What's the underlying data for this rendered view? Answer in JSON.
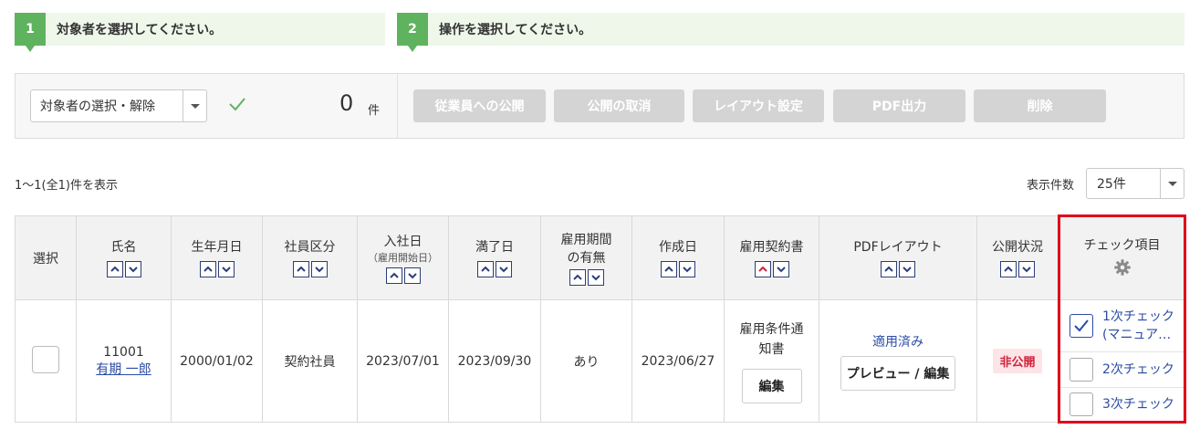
{
  "steps": [
    {
      "num": "1",
      "text": "対象者を選択してください。"
    },
    {
      "num": "2",
      "text": "操作を選択してください。"
    }
  ],
  "panel": {
    "target_select": "対象者の選択・解除",
    "count": "0",
    "count_unit": "件",
    "buttons": {
      "publish": "従業員への公開",
      "unpublish": "公開の取消",
      "layout": "レイアウト設定",
      "pdf": "PDF出力",
      "delete": "削除"
    },
    "button_color": "#d4d4d4"
  },
  "results": {
    "summary": "1〜1(全1)件を表示",
    "per_page_label": "表示件数",
    "per_page_value": "25件"
  },
  "table": {
    "headers": {
      "select": "選択",
      "name": "氏名",
      "birth": "生年月日",
      "emp_type": "社員区分",
      "join_line1": "入社日",
      "join_line2": "（雇用開始日）",
      "expire": "満了日",
      "period_line1": "雇用期間",
      "period_line2": "の有無",
      "created": "作成日",
      "contract": "雇用契約書",
      "pdf_layout": "PDFレイアウト",
      "status": "公開状況",
      "check_items": "チェック項目"
    },
    "row": {
      "emp_no": "11001",
      "name": "有期 一郎",
      "birth": "2000/01/02",
      "emp_type": "契約社員",
      "join": "2023/07/01",
      "expire": "2023/09/30",
      "period": "あり",
      "created": "2023/06/27",
      "contract_line1": "雇用条件通",
      "contract_line2": "知書",
      "contract_edit": "編集",
      "layout_status": "適用済み",
      "preview_edit": "プレビュー / 編集",
      "status": "非公開",
      "checks": [
        {
          "line1": "1次チェック",
          "line2": "(マニュア…",
          "checked": true
        },
        {
          "line1": "2次チェック",
          "checked": false
        },
        {
          "line1": "3次チェック",
          "checked": false
        }
      ]
    }
  },
  "colors": {
    "accent_green": "#5fb35f",
    "link_blue": "#2b4ba5",
    "highlight_red": "#e0001a",
    "badge_red": "#d0243c"
  }
}
